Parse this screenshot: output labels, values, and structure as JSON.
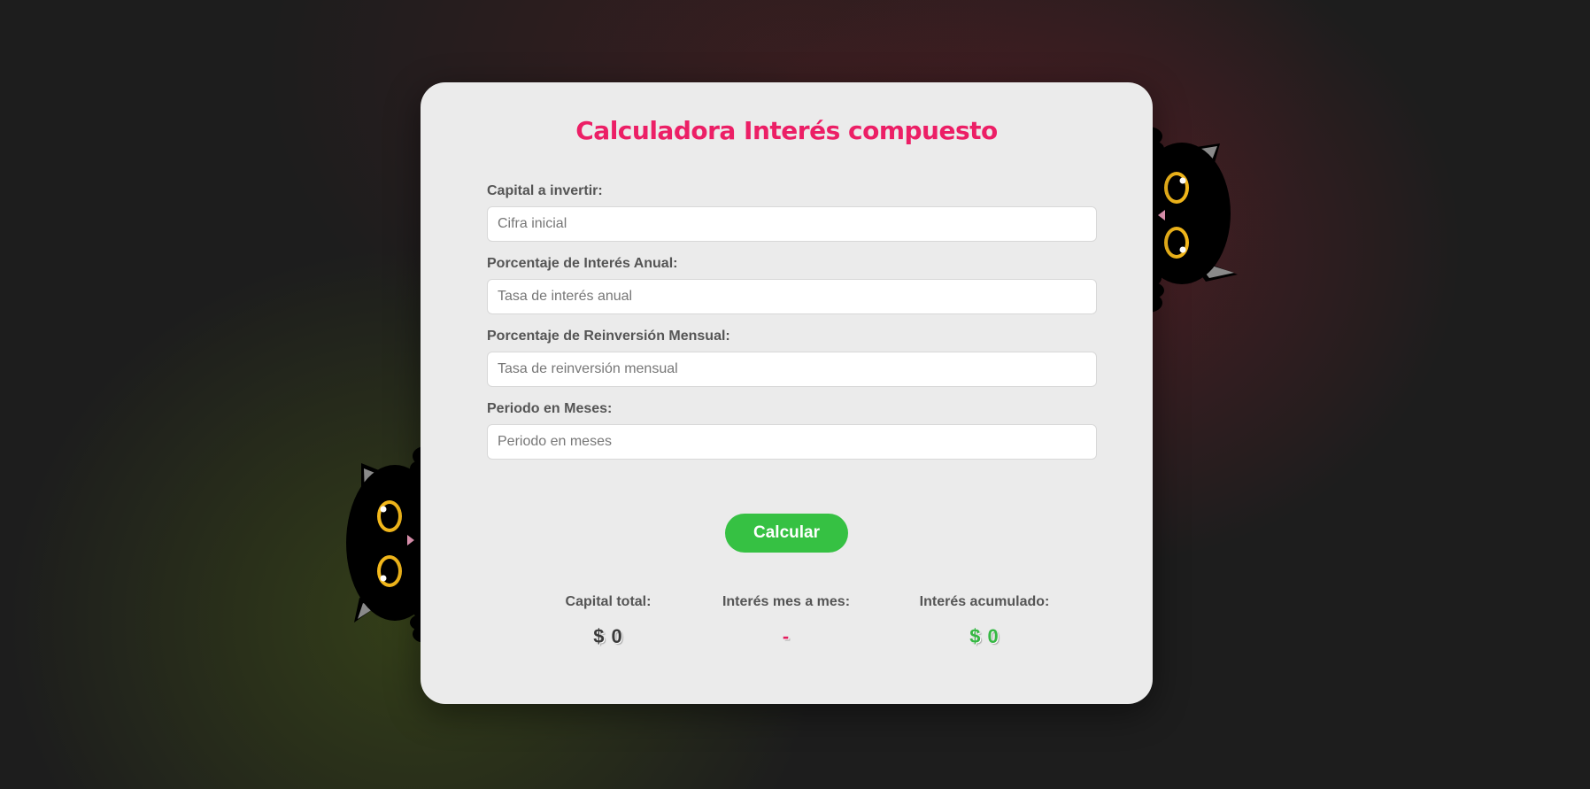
{
  "app": {
    "title": "Calculadora Interés compuesto"
  },
  "form": {
    "fields": [
      {
        "label": "Capital a invertir:",
        "placeholder": "Cifra inicial",
        "value": ""
      },
      {
        "label": "Porcentaje de Interés Anual:",
        "placeholder": "Tasa de interés anual",
        "value": ""
      },
      {
        "label": "Porcentaje de Reinversión Mensual:",
        "placeholder": "Tasa de reinversión mensual",
        "value": ""
      },
      {
        "label": "Periodo en Meses:",
        "placeholder": "Periodo en meses",
        "value": ""
      }
    ],
    "submit_label": "Calcular"
  },
  "results": {
    "capital_total": {
      "label": "Capital total:",
      "value": "$ 0"
    },
    "interes_mensual": {
      "label": "Interés mes a mes:",
      "value": "-"
    },
    "interes_acumulado": {
      "label": "Interés acumulado:",
      "value": "$ 0"
    }
  },
  "decorations": {
    "icons": [
      "black-cat-peeking-right-icon",
      "black-cat-peeking-left-icon"
    ]
  },
  "colors": {
    "title": "#ec1f66",
    "button": "#36c143",
    "card": "#ebebeb",
    "accent_green": "#36b844",
    "accent_pink": "#e21f5f"
  }
}
